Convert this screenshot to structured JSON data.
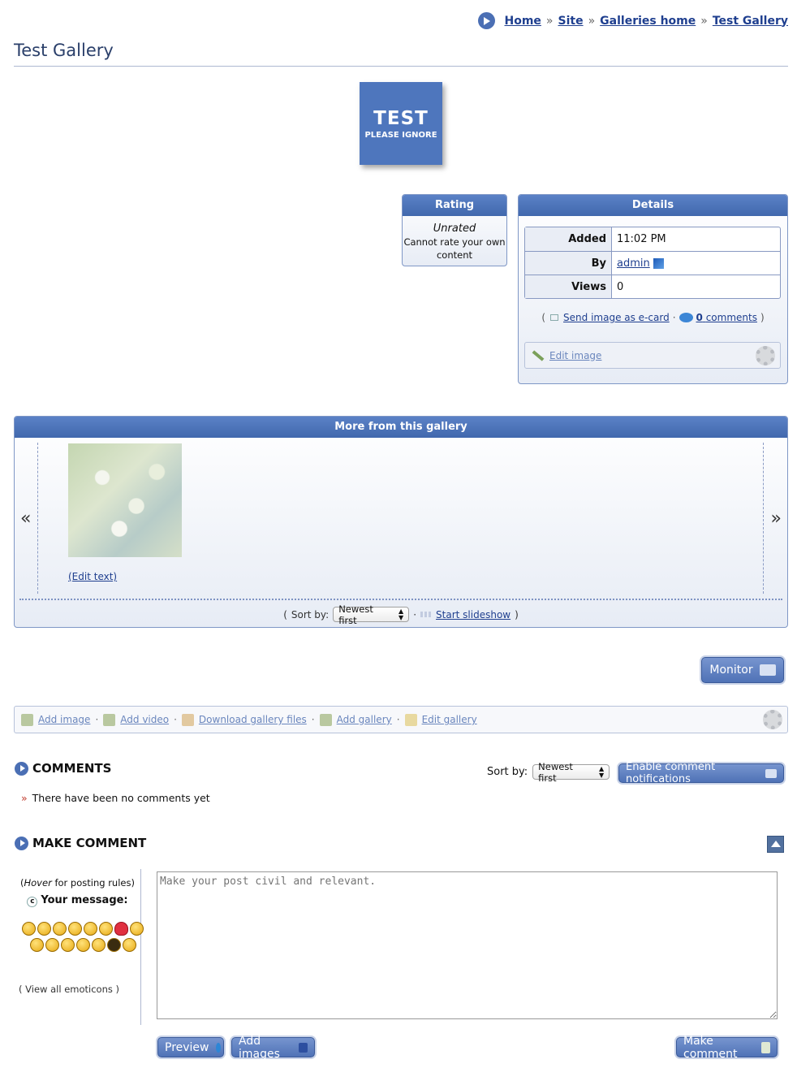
{
  "breadcrumb": {
    "items": [
      "Home",
      "Site",
      "Galleries home",
      "Test Gallery"
    ],
    "separator": "»"
  },
  "page_title": "Test Gallery",
  "test_image": {
    "big": "TEST",
    "small": "PLEASE IGNORE"
  },
  "rating": {
    "header": "Rating",
    "status": "Unrated",
    "note": "Cannot rate your own content"
  },
  "details": {
    "header": "Details",
    "rows": [
      {
        "key": "Added",
        "value": "11:02 PM"
      },
      {
        "key": "By",
        "value": "admin"
      },
      {
        "key": "Views",
        "value": "0"
      }
    ],
    "send_ecard": "Send image as e-card",
    "comments_count": "0",
    "comments_label": "comments",
    "edit_image": "Edit image"
  },
  "gallery": {
    "header": "More from this gallery",
    "prev": "«",
    "next": "»",
    "edit_text": "(Edit text)",
    "sort_label": "Sort by:",
    "sort_value": "Newest first",
    "start_slideshow": "Start slideshow"
  },
  "monitor_button": "Monitor",
  "actions": [
    "Add image",
    "Add video",
    "Download gallery files",
    "Add gallery",
    "Edit gallery"
  ],
  "comments": {
    "title": "COMMENTS",
    "sort_label": "Sort by:",
    "sort_value": "Newest first",
    "notify_button": "Enable comment notifications",
    "empty_text": "There have been no comments yet"
  },
  "make_comment": {
    "title": "MAKE COMMENT",
    "hover_word": "Hover",
    "hover_rest": "for posting rules",
    "your_message": "Your message:",
    "view_emoticons": "View all emoticons",
    "placeholder": "Make your post civil and relevant.",
    "preview_button": "Preview",
    "add_images_button": "Add images",
    "submit_button": "Make comment"
  },
  "colors": {
    "accent": "#4b6fb4",
    "header_blue": "#4168ad",
    "link": "#1f3f8f"
  }
}
